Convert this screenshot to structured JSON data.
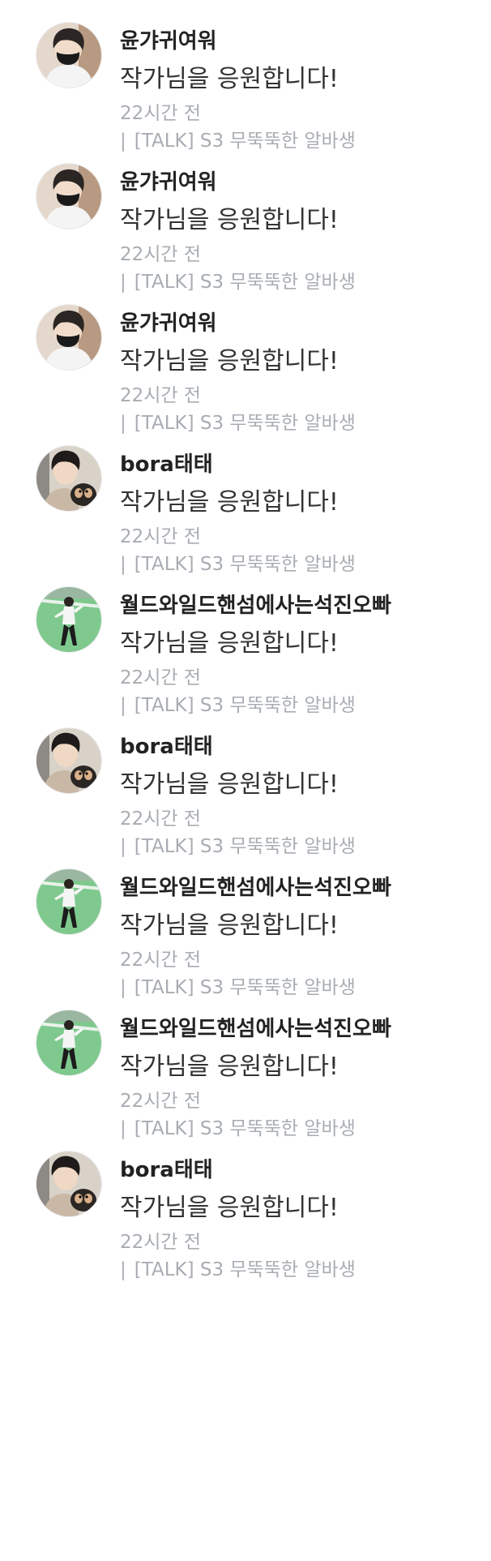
{
  "comments": [
    {
      "author": "윤갸귀여워",
      "avatar_icon": "person-face-mask-avatar-icon",
      "message": "작가님을 응원합니다!",
      "time": "22시간 전",
      "separator": "|",
      "source": "[TALK] S3 무뚝뚝한 알바생"
    },
    {
      "author": "윤갸귀여워",
      "avatar_icon": "person-face-mask-avatar-icon",
      "message": "작가님을 응원합니다!",
      "time": "22시간 전",
      "separator": "|",
      "source": "[TALK] S3 무뚝뚝한 알바생"
    },
    {
      "author": "윤갸귀여워",
      "avatar_icon": "person-face-mask-avatar-icon",
      "message": "작가님을 응원합니다!",
      "time": "22시간 전",
      "separator": "|",
      "source": "[TALK] S3 무뚝뚝한 알바생"
    },
    {
      "author": "bora태태",
      "avatar_icon": "person-with-dog-avatar-icon",
      "message": "작가님을 응원합니다!",
      "time": "22시간 전",
      "separator": "|",
      "source": "[TALK] S3 무뚝뚝한 알바생"
    },
    {
      "author": "월드와일드핸섬에사는석진오빠",
      "avatar_icon": "person-on-field-avatar-icon",
      "message": "작가님을 응원합니다!",
      "time": "22시간 전",
      "separator": "|",
      "source": "[TALK] S3 무뚝뚝한 알바생"
    },
    {
      "author": "bora태태",
      "avatar_icon": "person-with-dog-avatar-icon",
      "message": "작가님을 응원합니다!",
      "time": "22시간 전",
      "separator": "|",
      "source": "[TALK] S3 무뚝뚝한 알바생"
    },
    {
      "author": "월드와일드핸섬에사는석진오빠",
      "avatar_icon": "person-on-field-avatar-icon",
      "message": "작가님을 응원합니다!",
      "time": "22시간 전",
      "separator": "|",
      "source": "[TALK] S3 무뚝뚝한 알바생"
    },
    {
      "author": "월드와일드핸섬에사는석진오빠",
      "avatar_icon": "person-on-field-avatar-icon",
      "message": "작가님을 응원합니다!",
      "time": "22시간 전",
      "separator": "|",
      "source": "[TALK] S3 무뚝뚝한 알바생"
    },
    {
      "author": "bora태태",
      "avatar_icon": "person-with-dog-avatar-icon",
      "message": "작가님을 응원합니다!",
      "time": "22시간 전",
      "separator": "|",
      "source": "[TALK] S3 무뚝뚝한 알바생"
    }
  ],
  "colors": {
    "author": "#222222",
    "message": "#333333",
    "meta": "#a8adb3",
    "background": "#ffffff"
  }
}
